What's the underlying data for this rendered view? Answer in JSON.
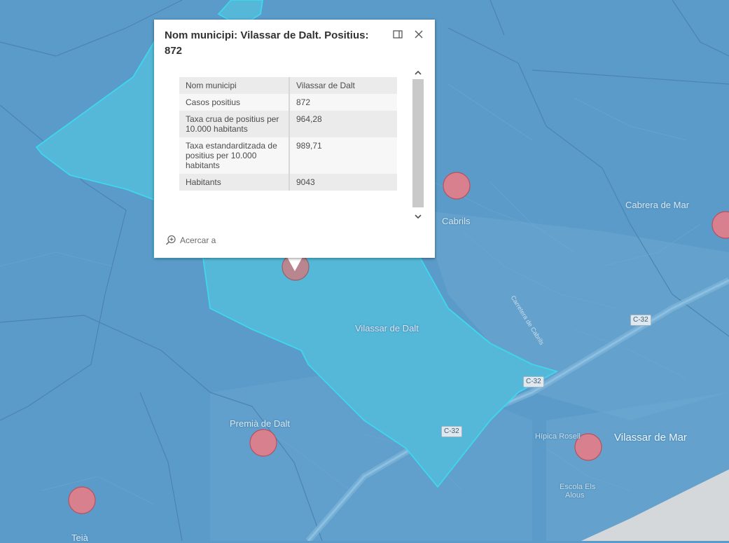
{
  "popup": {
    "title": "Nom municipi: Vilassar de Dalt. Positius: 872",
    "rows": [
      {
        "key": "Nom municipi",
        "value": "Vilassar de Dalt"
      },
      {
        "key": "Casos positius",
        "value": "872"
      },
      {
        "key": "Taxa crua de positius per 10.000 habitants",
        "value": "964,28"
      },
      {
        "key": "Taxa estandarditzada de positius per 10.000 habitants",
        "value": "989,71"
      },
      {
        "key": "Habitants",
        "value": "9043"
      }
    ],
    "zoom_label": "Acercar a",
    "dock_icon": "dock-panel-icon",
    "close_icon": "close-icon",
    "zoom_icon": "zoom-in-icon"
  },
  "map": {
    "labels": {
      "cabrils": "Cabrils",
      "cabrera": "Cabrera de Mar",
      "vilassar_dalt": "Vilassar de Dalt",
      "premia_dalt": "Premià de Dalt",
      "vilassar_mar": "Vilassar de Mar",
      "hipica": "Hípica Rosell",
      "escola_line1": "Escola Els",
      "escola_line2": "Alous",
      "teia": "Teià",
      "road_cabrils": "Carretera de Cabrils"
    },
    "shields": {
      "c32_a": "C-32",
      "c32_b": "C-32",
      "c32_c": "C-32"
    },
    "colors": {
      "background": "#5b9bc9",
      "highlight_fill": "#55b8d8",
      "highlight_outline": "#3fd6ee",
      "marker_fill": "#d9808e",
      "marker_outline": "#b8505f",
      "sea": "#d4d8da"
    }
  }
}
